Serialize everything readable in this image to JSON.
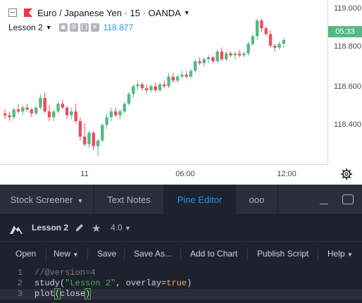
{
  "symbol": {
    "title": "Euro / Japanese Yen · 15 · OANDA",
    "flag_color": "#f23645"
  },
  "indicator": {
    "name": "Lesson 2",
    "value": "118.877",
    "icons": [
      "eye-icon",
      "settings-icon",
      "source-code-icon",
      "close-icon"
    ]
  },
  "price_scale": {
    "labels": [
      "119.000",
      "118.800",
      "118.600",
      "118.400"
    ],
    "last_price_time": "05:33",
    "last_price_color": "#53b987"
  },
  "time_axis": {
    "labels": [
      "11",
      "06:00",
      "12:00"
    ]
  },
  "chart_data": {
    "type": "candlestick",
    "ylim": [
      118.27,
      119.05
    ],
    "up_color": "#53b987",
    "down_color": "#eb4d5c",
    "line_color": "#2196f3",
    "candles": [
      [
        118.5,
        118.52,
        118.47,
        118.49
      ],
      [
        118.49,
        118.51,
        118.46,
        118.48
      ],
      [
        118.48,
        118.53,
        118.47,
        118.52
      ],
      [
        118.52,
        118.55,
        118.5,
        118.51
      ],
      [
        118.51,
        118.54,
        118.49,
        118.53
      ],
      [
        118.53,
        118.55,
        118.51,
        118.52
      ],
      [
        118.52,
        118.53,
        118.48,
        118.5
      ],
      [
        118.5,
        118.54,
        118.49,
        118.53
      ],
      [
        118.53,
        118.6,
        118.52,
        118.58
      ],
      [
        118.58,
        118.61,
        118.5,
        118.51
      ],
      [
        118.51,
        118.54,
        118.46,
        118.48
      ],
      [
        118.48,
        118.52,
        118.46,
        118.51
      ],
      [
        118.51,
        118.56,
        118.5,
        118.55
      ],
      [
        118.55,
        118.57,
        118.52,
        118.53
      ],
      [
        118.53,
        118.54,
        118.47,
        118.49
      ],
      [
        118.49,
        118.53,
        118.47,
        118.51
      ],
      [
        118.51,
        118.55,
        118.45,
        118.46
      ],
      [
        118.46,
        118.48,
        118.36,
        118.38
      ],
      [
        118.38,
        118.45,
        118.33,
        118.34
      ],
      [
        118.34,
        118.41,
        118.32,
        118.4
      ],
      [
        118.4,
        118.41,
        118.31,
        118.33
      ],
      [
        118.33,
        118.37,
        118.28,
        118.36
      ],
      [
        118.36,
        118.45,
        118.35,
        118.44
      ],
      [
        118.44,
        118.5,
        118.42,
        118.48
      ],
      [
        118.48,
        118.53,
        118.46,
        118.51
      ],
      [
        118.51,
        118.53,
        118.48,
        118.49
      ],
      [
        118.49,
        118.52,
        118.47,
        118.51
      ],
      [
        118.51,
        118.56,
        118.5,
        118.55
      ],
      [
        118.55,
        118.61,
        118.54,
        118.6
      ],
      [
        118.6,
        118.65,
        118.58,
        118.64
      ],
      [
        118.64,
        118.67,
        118.62,
        118.65
      ],
      [
        118.65,
        118.66,
        118.62,
        118.63
      ],
      [
        118.63,
        118.65,
        118.6,
        118.62
      ],
      [
        118.62,
        118.65,
        118.61,
        118.64
      ],
      [
        118.64,
        118.66,
        118.61,
        118.62
      ],
      [
        118.62,
        118.66,
        118.61,
        118.65
      ],
      [
        118.65,
        118.67,
        118.63,
        118.64
      ],
      [
        118.64,
        118.71,
        118.63,
        118.69
      ],
      [
        118.69,
        118.71,
        118.66,
        118.67
      ],
      [
        118.67,
        118.7,
        118.66,
        118.69
      ],
      [
        118.69,
        118.72,
        118.68,
        118.7
      ],
      [
        118.7,
        118.72,
        118.68,
        118.69
      ],
      [
        118.69,
        118.73,
        118.68,
        118.72
      ],
      [
        118.72,
        118.78,
        118.71,
        118.77
      ],
      [
        118.77,
        118.79,
        118.75,
        118.76
      ],
      [
        118.76,
        118.79,
        118.74,
        118.78
      ],
      [
        118.78,
        118.8,
        118.76,
        118.79
      ],
      [
        118.79,
        118.8,
        118.76,
        118.77
      ],
      [
        118.77,
        118.83,
        118.76,
        118.82
      ],
      [
        118.82,
        118.84,
        118.77,
        118.78
      ],
      [
        118.78,
        118.82,
        118.77,
        118.81
      ],
      [
        118.81,
        118.82,
        118.79,
        118.8
      ],
      [
        118.8,
        118.82,
        118.78,
        118.81
      ],
      [
        118.81,
        118.83,
        118.79,
        118.8
      ],
      [
        118.8,
        118.82,
        118.79,
        118.81
      ],
      [
        118.81,
        118.87,
        118.8,
        118.86
      ],
      [
        118.86,
        118.91,
        118.85,
        118.9
      ],
      [
        118.9,
        118.99,
        118.88,
        118.98
      ],
      [
        118.98,
        118.99,
        118.92,
        118.94
      ],
      [
        118.94,
        118.95,
        118.9,
        118.91
      ],
      [
        118.91,
        118.93,
        118.84,
        118.85
      ],
      [
        118.85,
        118.86,
        118.82,
        118.84
      ],
      [
        118.84,
        118.87,
        118.83,
        118.86
      ],
      [
        118.86,
        118.89,
        118.84,
        118.88
      ]
    ]
  },
  "bottom_tabs": {
    "stock_screener": "Stock Screener",
    "text_notes": "Text Notes",
    "pine_editor": "Pine Editor",
    "more": "ooo"
  },
  "script": {
    "name": "Lesson 2",
    "version": "4.0"
  },
  "toolbar": {
    "open": "Open",
    "new": "New",
    "save": "Save",
    "save_as": "Save As...",
    "add_to_chart": "Add to Chart",
    "publish_script": "Publish Script",
    "help": "Help"
  },
  "editor": {
    "line_numbers": [
      "1",
      "2",
      "3"
    ],
    "line1": "//@version=4",
    "line2_fn": "study(",
    "line2_str": "\"Lesson 2\"",
    "line2_mid": ", overlay=",
    "line2_bool": "true",
    "line2_end": ")",
    "line3_fn": "plot",
    "line3_open": "(",
    "line3_arg": "close",
    "line3_close": ")"
  }
}
